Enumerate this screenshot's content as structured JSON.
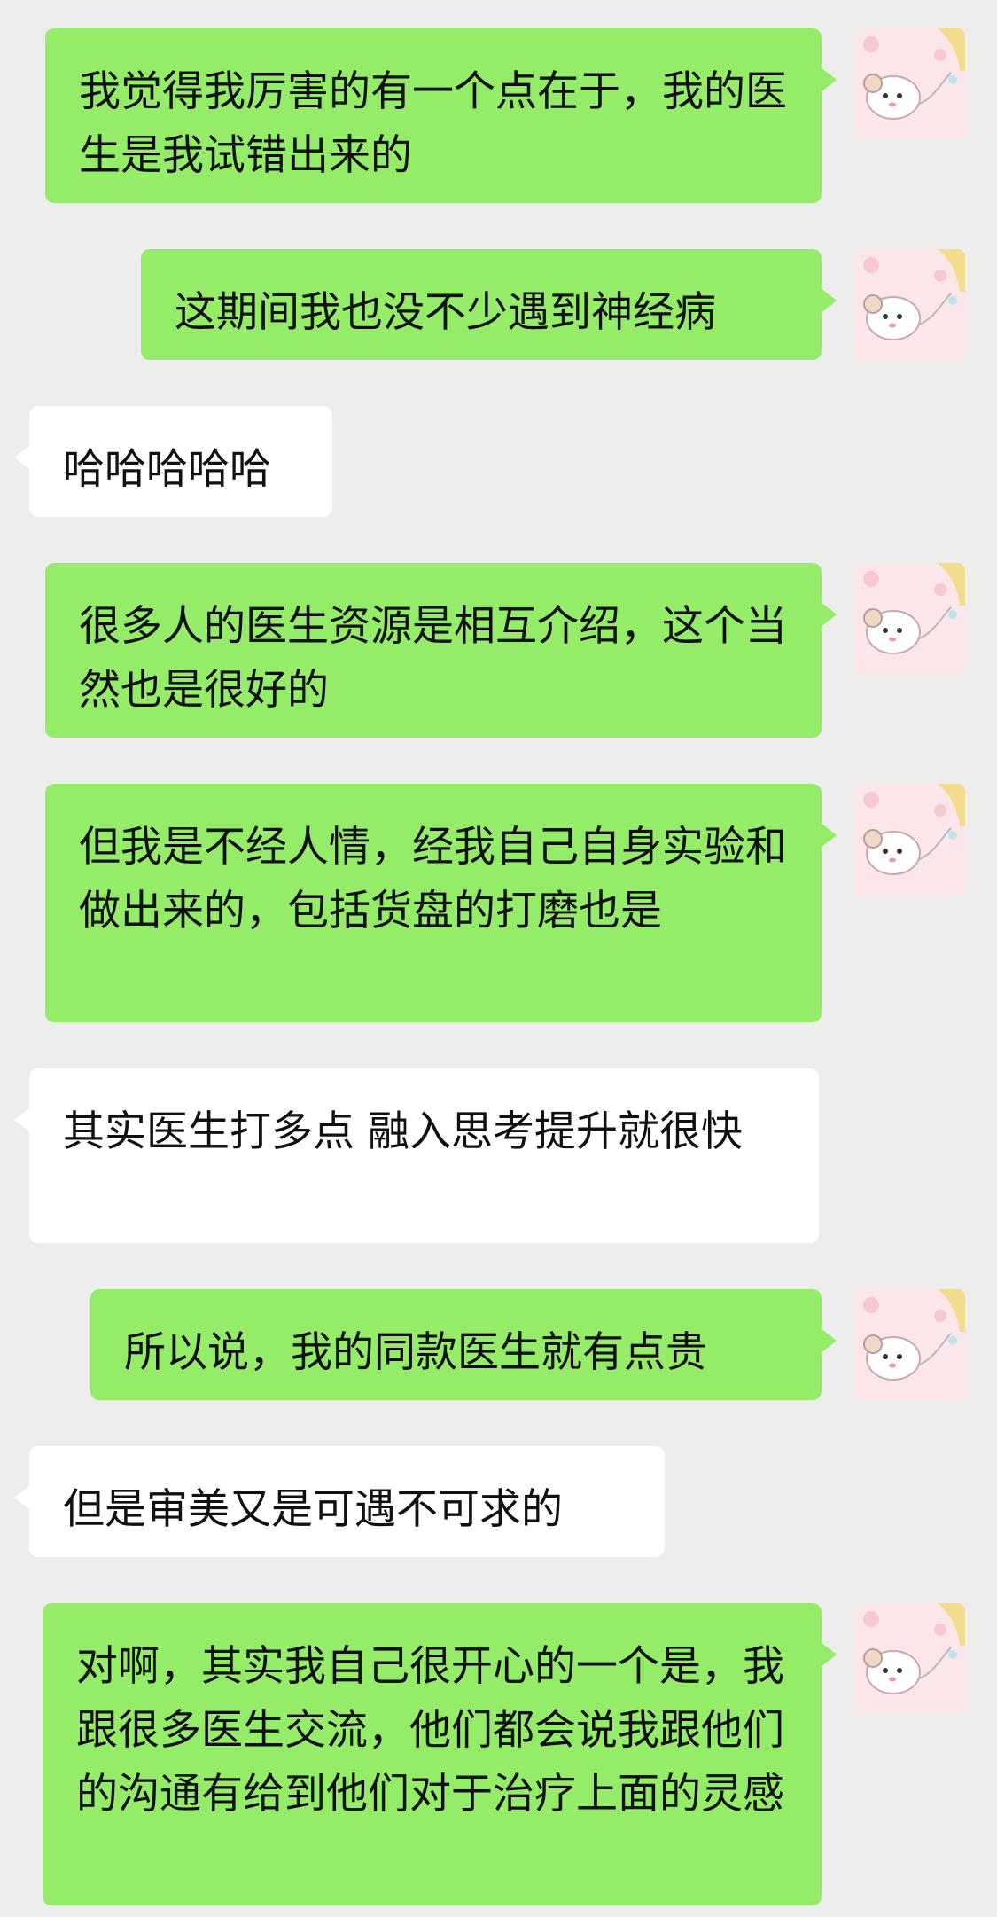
{
  "chat": {
    "messages": [
      {
        "side": "out",
        "text": "我觉得我厉害的有一个点在于，我的医生是我试错出来的"
      },
      {
        "side": "out",
        "text": "这期间我也没不少遇到神经病"
      },
      {
        "side": "in",
        "text": "哈哈哈哈哈"
      },
      {
        "side": "out",
        "text": "很多人的医生资源是相互介绍，这个当然也是很好的"
      },
      {
        "side": "out",
        "text": "但我是不经人情，经我自己自身实验和做出来的，包括货盘的打磨也是"
      },
      {
        "side": "in",
        "text": "其实医生打多点 融入思考提升就很快"
      },
      {
        "side": "out",
        "text": "所以说，我的同款医生就有点贵"
      },
      {
        "side": "in",
        "text": "但是审美又是可遇不可求的"
      },
      {
        "side": "out",
        "text": "对啊，其实我自己很开心的一个是，我跟很多医生交流，他们都会说我跟他们的沟通有给到他们对于治疗上面的灵感"
      }
    ],
    "avatar_icon": "cartoon-mouse-avatar-icon",
    "colors": {
      "background": "#ededed",
      "outgoing_bubble": "#95ec69",
      "incoming_bubble": "#ffffff",
      "text": "#111111"
    }
  }
}
